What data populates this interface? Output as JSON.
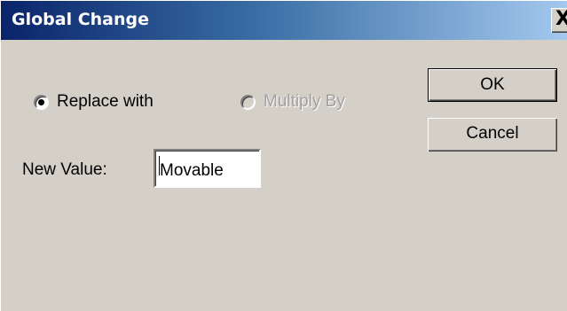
{
  "window": {
    "title": "Global Change",
    "close_glyph": "X"
  },
  "options": {
    "replace_label": "Replace with",
    "replace_selected": true,
    "multiply_label": "Multiply By",
    "multiply_enabled": false
  },
  "new_value": {
    "label": "New Value:",
    "value": "Movable"
  },
  "buttons": {
    "ok_label": "OK",
    "cancel_label": "Cancel"
  },
  "colors": {
    "dialog_face": "#d4d0c8",
    "titlebar_start": "#0a246a",
    "titlebar_end": "#a6caf0"
  }
}
